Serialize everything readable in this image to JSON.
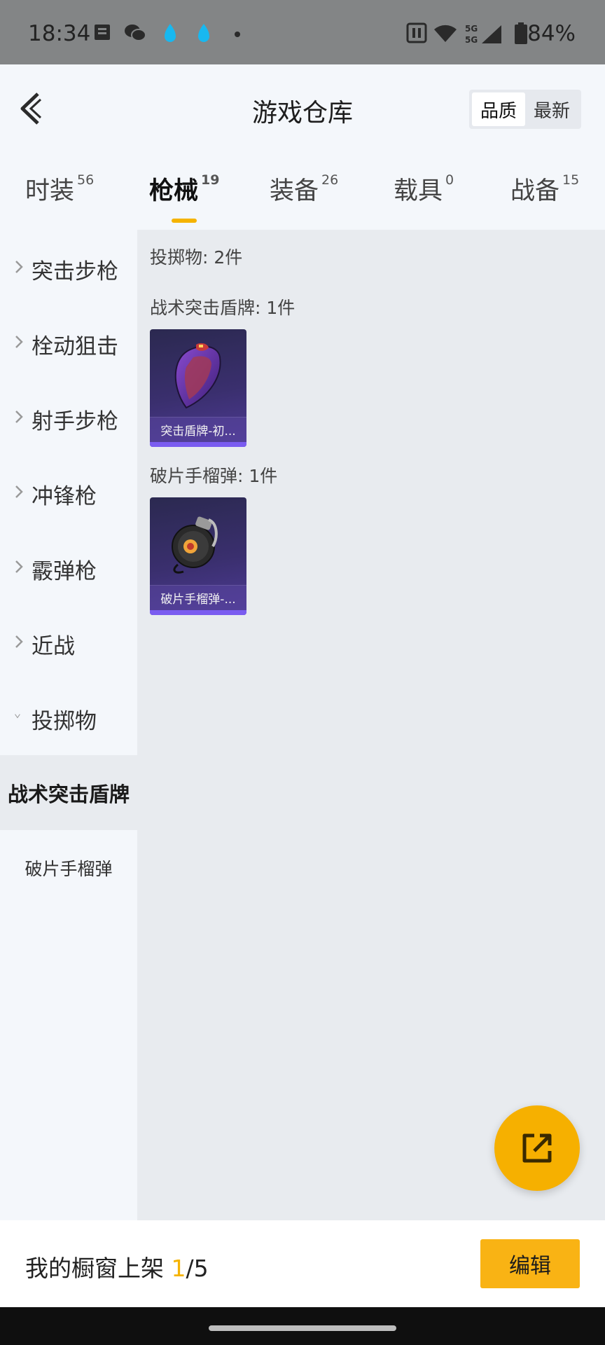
{
  "status_bar": {
    "time": "18:34",
    "battery": "84%",
    "icons": [
      "notes-icon",
      "wechat-icon",
      "drop-icon",
      "drop-icon",
      "dot-icon",
      "nfc-icon",
      "wifi-icon",
      "signal-5g-icon",
      "battery-icon"
    ]
  },
  "header": {
    "title": "游戏仓库",
    "sort_quality": "品质",
    "sort_latest": "最新"
  },
  "tabs": [
    {
      "label": "时装",
      "count": "56"
    },
    {
      "label": "枪械",
      "count": "19"
    },
    {
      "label": "装备",
      "count": "26"
    },
    {
      "label": "载具",
      "count": "0"
    },
    {
      "label": "战备",
      "count": "15"
    }
  ],
  "sidebar": {
    "items": [
      "突击步枪",
      "栓动狙击",
      "射手步枪",
      "冲锋枪",
      "霰弹枪",
      "近战",
      "投掷物"
    ],
    "sub_items": [
      "战术突击盾牌",
      "破片手榴弹"
    ]
  },
  "main": {
    "category_count": "投掷物: 2件",
    "groups": [
      {
        "title": "战术突击盾牌: 1件",
        "item_label": "突击盾牌-初..."
      },
      {
        "title": "破片手榴弹: 1件",
        "item_label": "破片手榴弹-..."
      }
    ]
  },
  "bottom": {
    "showcase_prefix": "我的橱窗上架 ",
    "showcase_current": "1",
    "showcase_total": "/5",
    "edit_label": "编辑"
  },
  "colors": {
    "accent": "#f5b300",
    "card_bg": "#3a2f6e",
    "panel_bg": "#e8ebef"
  }
}
